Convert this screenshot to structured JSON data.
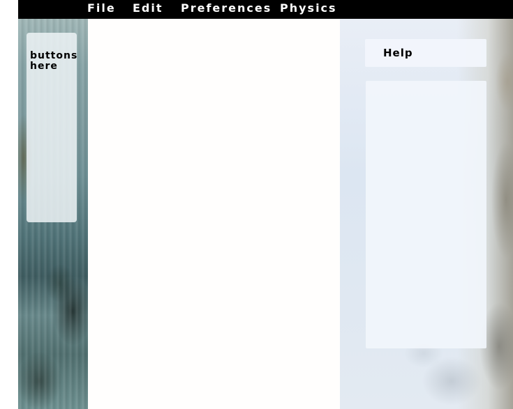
{
  "menubar": {
    "items": [
      {
        "label": "File"
      },
      {
        "label": "Edit"
      },
      {
        "label": "Preferences"
      },
      {
        "label": "Physics"
      }
    ],
    "background": "#000000",
    "text_color": "#ffffff"
  },
  "left_panel": {
    "placeholder_text": "buttons here"
  },
  "help": {
    "title": "Help",
    "content": ""
  },
  "colors": {
    "canvas": "#fffefd",
    "panel_overlay": "#eef3f6"
  }
}
